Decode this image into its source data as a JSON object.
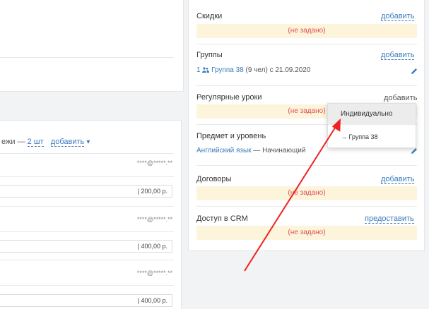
{
  "left": {
    "payments": {
      "label": "ежи —",
      "count_link": "2 шт",
      "add_label": "добавить",
      "caret": "▾",
      "rows": [
        {
          "masked": "****@*****.**",
          "amount": "| 200,00 р."
        },
        {
          "masked": "****@*****.**",
          "amount": "| 400,00 р."
        },
        {
          "masked": "****@*****.**",
          "amount": "| 400,00 р."
        }
      ]
    }
  },
  "right": {
    "discounts": {
      "title": "Скидки",
      "add": "добавить",
      "empty": "(не задано)"
    },
    "groups": {
      "title": "Группы",
      "add": "добавить",
      "item_count": "1",
      "item_link": "Группа 38",
      "item_meta": "(9 чел)  с 21.09.2020"
    },
    "regular_lessons": {
      "title": "Регулярные уроки",
      "add": "добавить",
      "empty": "(не задано)"
    },
    "subject": {
      "title": "Предмет и уровень",
      "language_link": "Английский язык",
      "level": "— Начинающий"
    },
    "contracts": {
      "title": "Договоры",
      "add": "добавить",
      "empty": "(не задано)"
    },
    "crm": {
      "title": "Доступ в CRM",
      "add": "предоставить",
      "empty": "(не задано)"
    }
  },
  "dropdown": {
    "items": [
      "Индивидуально",
      "→ Группа 38"
    ]
  },
  "colors": {
    "link": "#3b7bbf",
    "empty_bg": "#fdf4dc",
    "empty_text": "#e05050",
    "arrow": "#ee2222"
  }
}
